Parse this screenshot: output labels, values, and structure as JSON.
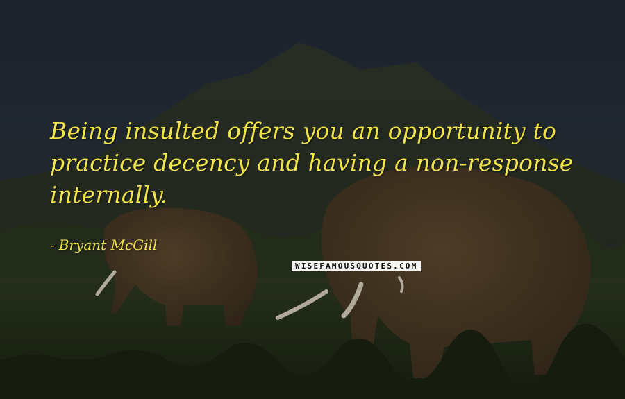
{
  "quote": {
    "text": "Being insulted offers you an opportunity to practice decency and having a non-response internally.",
    "author": "Bryant McGill"
  },
  "watermark": {
    "text": "WISEFAMOUSQUOTES.COM"
  },
  "colors": {
    "quote_text": "#f1e34a",
    "watermark_bg": "#f4f4f0",
    "watermark_text": "#0d0d0d"
  }
}
